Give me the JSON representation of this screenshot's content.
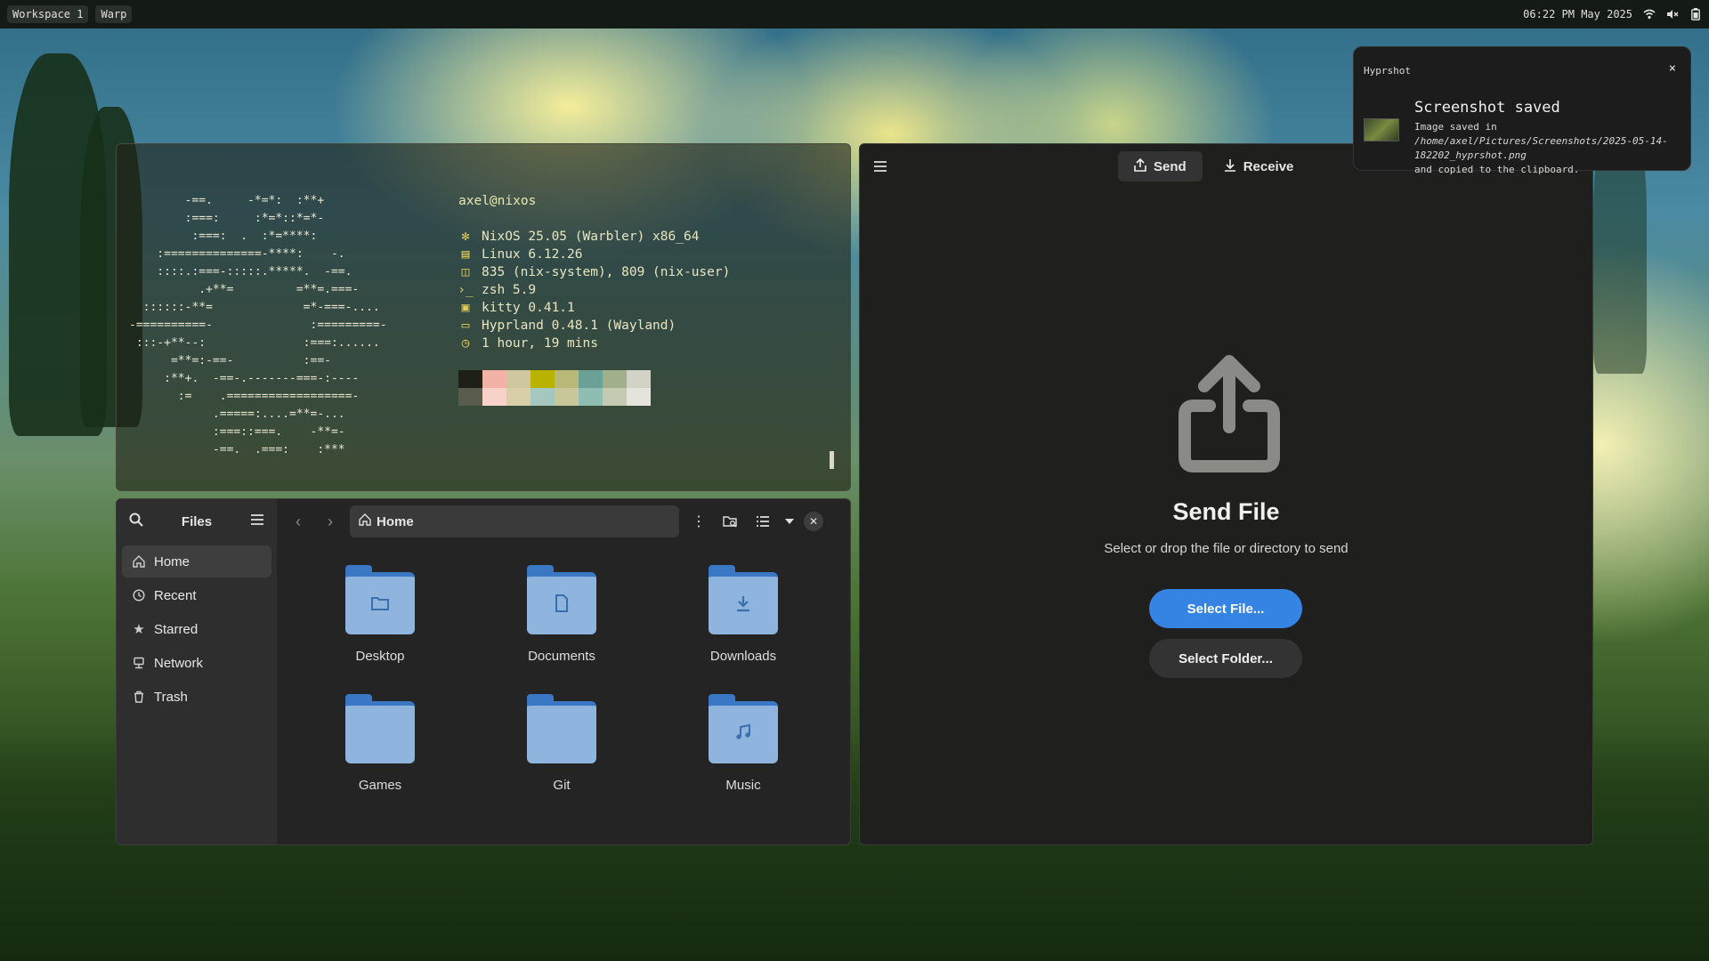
{
  "topbar": {
    "workspace": "Workspace 1",
    "app": "Warp",
    "clock": "06:22 PM May 2025",
    "tray_icons": [
      "wifi-icon",
      "volume-muted-icon",
      "battery-icon"
    ]
  },
  "terminal": {
    "ascii_art": "        -==.     -*=*:  :**+\n        :===:     :*=*::*=*-\n         :===:  .  :*=****:\n    :==============-****:    -.\n    ::::.:===-:::::.*****.  -==.\n          .+**=         =**=.===-\n  ::::::-**=             =*-===-....\n-==========-              :=========-\n :::-+**--:              :===:......\n      =**=:-==-          :==-\n     :**+.  -==-.-------===-:----\n       :=    .==================-\n            .=====:....=**=-...\n            :===::===.    -**=-\n            -==.  .===:    :***",
    "user": "axel@nixos",
    "info": [
      {
        "icon": "nixos-icon",
        "text": "NixOS 25.05 (Warbler) x86_64"
      },
      {
        "icon": "kernel-icon",
        "text": "Linux 6.12.26"
      },
      {
        "icon": "package-icon",
        "text": "835 (nix-system), 809 (nix-user)"
      },
      {
        "icon": "shell-icon",
        "text": "zsh 5.9"
      },
      {
        "icon": "terminal-icon",
        "text": "kitty 0.41.1"
      },
      {
        "icon": "window-manager-icon",
        "text": "Hyprland 0.48.1 (Wayland)"
      },
      {
        "icon": "clock-icon",
        "text": "1 hour, 19 mins"
      }
    ],
    "palette_top": [
      "#1e1f17",
      "#f2b2a6",
      "#cfc7a0",
      "#b9b300",
      "#b8b878",
      "#6aa095",
      "#a0b08a",
      "#d2d3c6"
    ],
    "palette_bottom": [
      "#595b4d",
      "#f7d2c8",
      "#d8cfa8",
      "#a6c7c0",
      "#c7c79a",
      "#8fbdb2",
      "#c4cbb2",
      "#e4e4dc"
    ]
  },
  "files": {
    "title": "Files",
    "sidebar": [
      {
        "label": "Home",
        "icon": "home-icon",
        "active": true
      },
      {
        "label": "Recent",
        "icon": "recent-icon",
        "active": false
      },
      {
        "label": "Starred",
        "icon": "star-icon",
        "active": false
      },
      {
        "label": "Network",
        "icon": "network-icon",
        "active": false
      },
      {
        "label": "Trash",
        "icon": "trash-icon",
        "active": false
      }
    ],
    "path": "Home",
    "folders": [
      {
        "name": "Desktop",
        "icon": "desktop-folder-icon"
      },
      {
        "name": "Documents",
        "icon": "documents-folder-icon"
      },
      {
        "name": "Downloads",
        "icon": "downloads-folder-icon"
      },
      {
        "name": "Games",
        "icon": "folder-icon"
      },
      {
        "name": "Git",
        "icon": "folder-icon"
      },
      {
        "name": "Music",
        "icon": "music-folder-icon"
      }
    ]
  },
  "send": {
    "tabs": [
      {
        "label": "Send",
        "icon": "upload-icon",
        "active": true
      },
      {
        "label": "Receive",
        "icon": "download-icon",
        "active": false
      }
    ],
    "title": "Send File",
    "subtitle": "Select or drop the file or directory to send",
    "select_file": "Select File...",
    "select_folder": "Select Folder..."
  },
  "notification": {
    "app": "Hyprshot",
    "title": "Screenshot saved",
    "body_prefix": "Image saved in ",
    "body_path": "/home/axel/Pictures/Screenshots/2025-05-14-182202_hyprshot.png",
    "body_suffix": "and copied to the clipboard.",
    "close": "×"
  },
  "colors": {
    "accent": "#3584e4",
    "terminal_icon": "#e4cf56",
    "folder_blue": "#3a78c6"
  }
}
